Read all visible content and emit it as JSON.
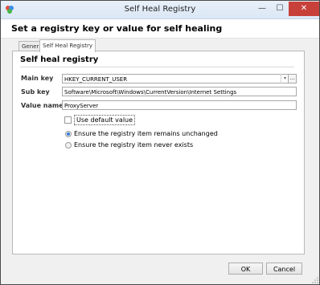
{
  "window": {
    "title": "Self Heal Registry",
    "minimize_glyph": "—",
    "maximize_glyph": "☐",
    "close_glyph": "✕"
  },
  "dialog": {
    "heading": "Set a registry key or value for self healing"
  },
  "tabs": [
    {
      "label": "General",
      "active": false
    },
    {
      "label": "Self Heal Registry",
      "active": true
    }
  ],
  "panel": {
    "title": "Self heal registry",
    "main_key": {
      "label": "Main key",
      "value": "HKEY_CURRENT_USER",
      "browse_label": "..."
    },
    "sub_key": {
      "label": "Sub key",
      "value": "Software\\Microsoft\\Windows\\CurrentVersion\\Internet Settings"
    },
    "value_name": {
      "label": "Value name",
      "value": "ProxyServer"
    },
    "use_default": {
      "label": "Use default value",
      "checked": false
    },
    "options": [
      {
        "label": "Ensure the registry item remains unchanged",
        "selected": true
      },
      {
        "label": "Ensure the registry item never exists",
        "selected": false
      }
    ]
  },
  "buttons": {
    "ok": "OK",
    "cancel": "Cancel"
  }
}
